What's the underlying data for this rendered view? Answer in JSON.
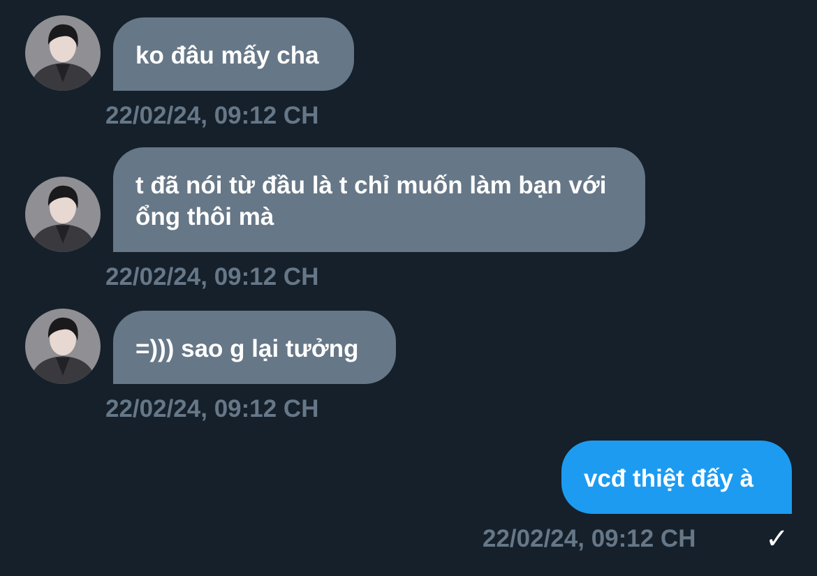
{
  "messages": [
    {
      "text": "ko đâu mấy cha",
      "time": "22/02/24, 09:12 CH",
      "direction": "incoming"
    },
    {
      "text": "t đã nói từ đầu là t chỉ muốn làm bạn với ổng thôi mà",
      "time": "22/02/24, 09:12 CH",
      "direction": "incoming"
    },
    {
      "text": "=))) sao g lại tưởng",
      "time": "22/02/24, 09:12 CH",
      "direction": "incoming"
    },
    {
      "text": "vcđ thiệt đấy à",
      "time": "22/02/24, 09:12 CH",
      "direction": "outgoing",
      "status_icon": "checkmark-icon"
    }
  ],
  "colors": {
    "background": "#15202b",
    "incoming_bubble": "#667787",
    "outgoing_bubble": "#1d9bf0",
    "timestamp": "#667787",
    "text": "#ffffff"
  }
}
